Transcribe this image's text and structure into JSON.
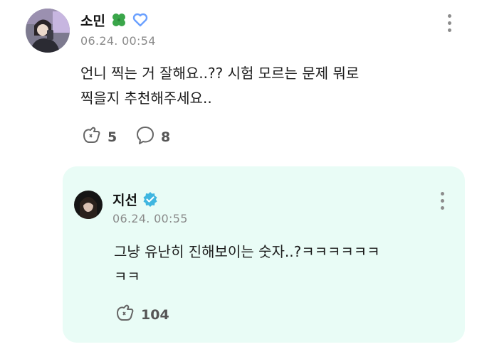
{
  "post": {
    "author": "소민",
    "timestamp": "06.24. 00:54",
    "text_line1": "언니 찍는 거 잘해요..?? 시험 모르는 문제 뭐로",
    "text_line2": "찍을지 추천해주세요..",
    "like_count": "5",
    "comment_count": "8",
    "author_badges": [
      "four-leaf-clover-icon",
      "heart-outline-icon"
    ]
  },
  "reply": {
    "author": "지선",
    "timestamp": "06.24. 00:55",
    "text_line1": "그냥 유난히 진해보이는 숫자..?ㅋㅋㅋㅋㅋㅋ",
    "text_line2": "ㅋㅋ",
    "like_count": "104",
    "author_badges": [
      "verified-check-icon"
    ]
  },
  "colors": {
    "reply_background": "#e9fcf6",
    "verified": "#3fb6e0",
    "clover": "#3aa64a",
    "heart_outline": "#6aa0ff"
  }
}
